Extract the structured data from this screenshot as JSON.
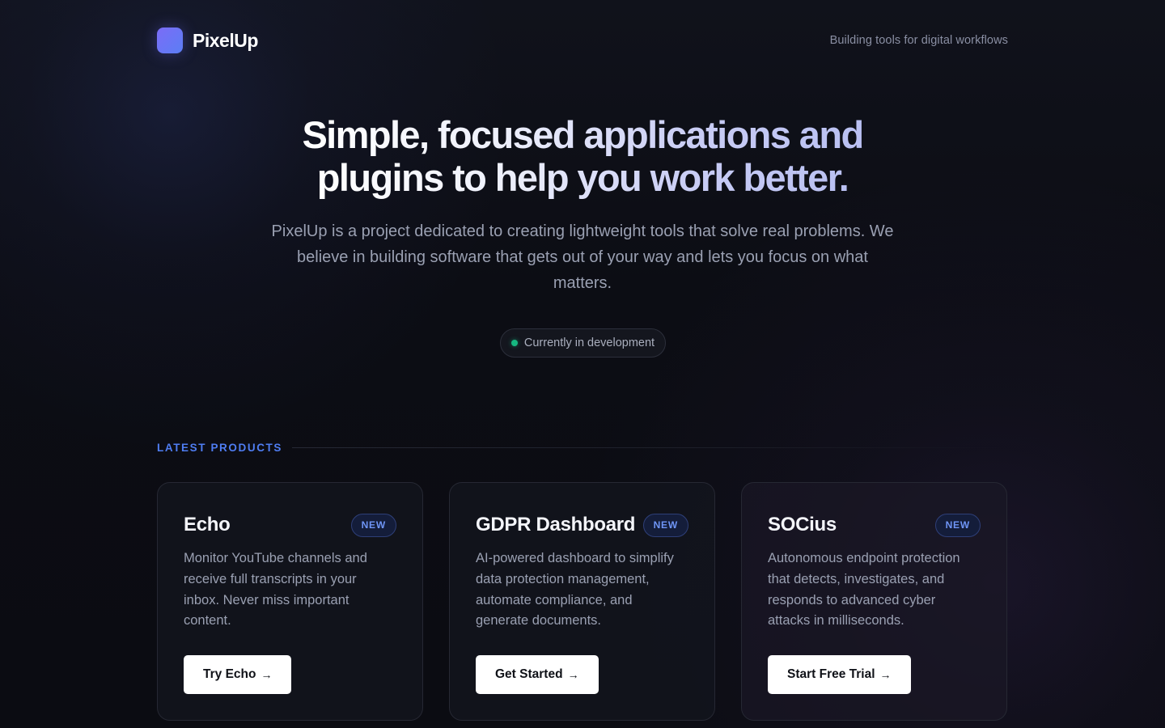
{
  "brand": {
    "name": "PixelUp",
    "tagline": "Building tools for digital workflows"
  },
  "hero": {
    "title_line1": "Simple, focused applications and",
    "title_line2": "plugins to help you work better.",
    "description": "PixelUp is a project dedicated to creating lightweight tools that solve real problems. We believe in building software that gets out of your way and lets you focus on what matters.",
    "status": "Currently in development"
  },
  "section": {
    "label": "LATEST PRODUCTS"
  },
  "products": [
    {
      "name": "Echo",
      "badge": "NEW",
      "description": "Monitor YouTube channels and receive full transcripts in your inbox. Never miss important content.",
      "cta": "Try Echo",
      "cta_arrow": "→"
    },
    {
      "name": "GDPR Dashboard",
      "badge": "NEW",
      "description": "AI-powered dashboard to simplify data protection management, automate compliance, and generate documents.",
      "cta": "Get Started",
      "cta_arrow": "→"
    },
    {
      "name": "SOCius",
      "badge": "NEW",
      "description": "Autonomous endpoint protection that detects, investigates, and responds to advanced cyber attacks in milliseconds.",
      "cta": "Start Free Trial",
      "cta_arrow": "→"
    }
  ],
  "colors": {
    "accent": "#4f7df2",
    "status_dot": "#16b981",
    "background": "#0b0c12",
    "logo_gradient_start": "#7b6cf6",
    "logo_gradient_end": "#5b7ef5"
  }
}
